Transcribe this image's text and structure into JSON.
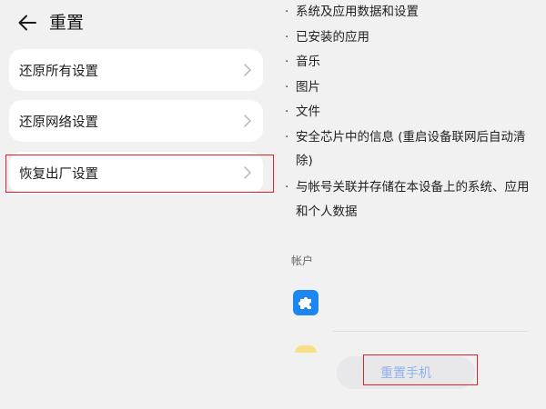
{
  "header": {
    "back_icon": "arrow-left-icon",
    "title": "重置"
  },
  "menu": {
    "items": [
      {
        "label": "还原所有设置"
      },
      {
        "label": "还原网络设置"
      },
      {
        "label": "恢复出厂设置"
      }
    ],
    "chevron_icon": "chevron-right-icon"
  },
  "details": {
    "bullets": [
      "系统及应用数据和设置",
      "已安装的应用",
      "音乐",
      "图片",
      "文件",
      "安全芯片中的信息 (重启设备联网后自动清",
      "与帐号关联并存储在本设备上的系统、应用"
    ],
    "continuations": {
      "secure_chip": "除)",
      "account_data": "和个人数据"
    }
  },
  "accounts": {
    "section_label": "帐户",
    "first_icon": "puzzle-icon",
    "icon_color": "#1e86f0"
  },
  "actions": {
    "reset_label": "重置手机"
  },
  "colors": {
    "highlight_border": "#e0202a",
    "reset_text": "#8fb2ea",
    "background": "#f1f1f1"
  }
}
